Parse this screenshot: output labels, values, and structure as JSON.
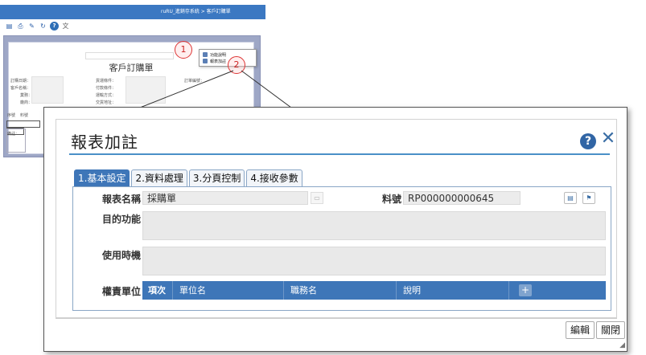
{
  "background": {
    "breadcrumb": "ruRU_進銷存系統 > 客戶訂購單",
    "toolbar_icons": [
      "report-icon",
      "print-icon",
      "pencil-icon",
      "refresh-icon",
      "help-icon",
      "translate-icon"
    ],
    "report_title": "客戶訂購單",
    "form_labels": [
      "訂購日期：",
      "客戶名稱：",
      "業務：",
      "廠商：",
      "貨運條件：",
      "付款條件：",
      "運輸方式：",
      "交貨地址：",
      "訂單編號："
    ],
    "grid_labels": [
      "序號",
      "料號"
    ],
    "note_label": "備註：",
    "context_menu": [
      "功能說明",
      "報表加註"
    ],
    "markers": [
      "1",
      "2"
    ]
  },
  "dialog": {
    "title": "報表加註",
    "tabs": [
      {
        "label": "1.基本設定",
        "active": true
      },
      {
        "label": "2.資料處理",
        "active": false
      },
      {
        "label": "3.分頁控制",
        "active": false
      },
      {
        "label": "4.接收參數",
        "active": false
      }
    ],
    "fields": {
      "report_name_label": "報表名稱",
      "report_name_value": "採購單",
      "material_no_label": "料號",
      "material_no_value": "RP000000000645",
      "purpose_label": "目的功能",
      "usage_label": "使用時機",
      "responsibility_label": "權責單位"
    },
    "grid": {
      "columns": [
        "項次",
        "單位名",
        "職務名",
        "說明"
      ]
    },
    "buttons": {
      "edit": "編輯",
      "close": "關閉"
    },
    "colors": {
      "accent": "#3e76b8",
      "help_button": "#3165a5",
      "marker": "#dd3333"
    }
  }
}
